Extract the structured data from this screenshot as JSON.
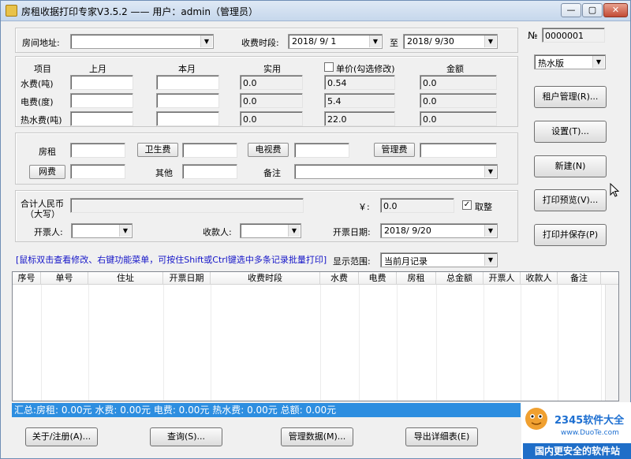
{
  "title": "房租收据打印专家V3.5.2 —— 用户：admin（管理员）",
  "window_buttons": {
    "min": "—",
    "max": "▢",
    "close": "✕"
  },
  "form": {
    "address_label": "房间地址:",
    "period_label": "收费时段:",
    "period_start": "2018/ 9/ 1",
    "to_label": "至",
    "period_end": "2018/ 9/30"
  },
  "receipt_no": {
    "prefix": "№",
    "value": "0000001"
  },
  "template_select": "热水版",
  "meters": {
    "hdr_item": "项目",
    "hdr_last": "上月",
    "hdr_this": "本月",
    "hdr_actual": "实用",
    "hdr_unit": "单价(勾选修改)",
    "hdr_amount": "金额",
    "rows": [
      {
        "label": "水费(吨)",
        "actual": "0.0",
        "unit": "0.54",
        "amount": "0.0"
      },
      {
        "label": "电费(度)",
        "actual": "0.0",
        "unit": "5.4",
        "amount": "0.0"
      },
      {
        "label": "热水费(吨)",
        "actual": "0.0",
        "unit": "22.0",
        "amount": "0.0"
      }
    ]
  },
  "fees": {
    "rent": "房租",
    "sanitation": "卫生费",
    "tv": "电视费",
    "management": "管理费",
    "internet": "网费",
    "other": "其他",
    "remark": "备注"
  },
  "totals": {
    "cn_label_1": "合计人民币",
    "cn_label_2": "（大写）",
    "yen_label": "￥:",
    "yen_value": "0.0",
    "round_label": "取整",
    "issuer_label": "开票人:",
    "payee_label": "收款人:",
    "issue_date_label": "开票日期:",
    "issue_date": "2018/ 9/20"
  },
  "side_buttons": [
    "租户管理(R)...",
    "设置(T)...",
    "新建(N)",
    "打印预览(V)...",
    "打印并保存(P)"
  ],
  "hint": "[鼠标双击查看修改、右键功能菜单，可按住Shift或Ctrl键选中多条记录批量打印]",
  "range_label": "显示范围:",
  "range_value": "当前月记录",
  "table_columns": [
    "序号",
    "单号",
    "住址",
    "开票日期",
    "收费时段",
    "水费",
    "电费",
    "房租",
    "总金额",
    "开票人",
    "收款人",
    "备注"
  ],
  "summary": "汇总:房租: 0.00元  水费: 0.00元  电费: 0.00元  热水费: 0.00元  总额: 0.00元",
  "bottom_buttons": [
    "关于/注册(A)...",
    "查询(S)...",
    "管理数据(M)...",
    "导出详细表(E)"
  ],
  "watermark": {
    "brand": "2345软件大全",
    "site": "www.DuoTe.com",
    "slogan": "国内更安全的软件站"
  }
}
